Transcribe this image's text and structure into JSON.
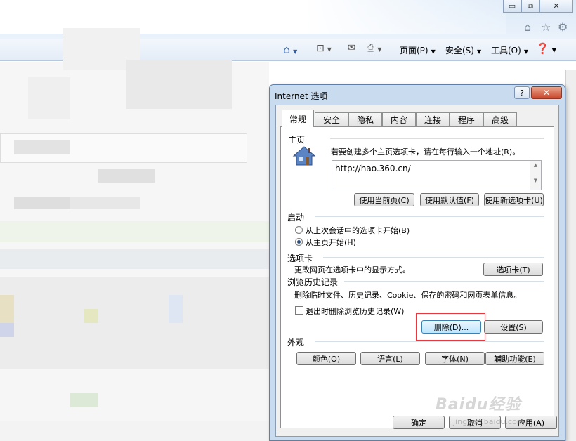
{
  "browser": {
    "window_controls": {
      "minimize": "▭",
      "restore": "⧉",
      "close": "✕"
    },
    "command_bar": {
      "page_label": "页面(P)",
      "safety_label": "安全(S)",
      "tools_label": "工具(O)"
    },
    "icons": [
      "home-icon",
      "star-icon",
      "gear-icon",
      "feeds-icon",
      "mail-icon",
      "print-icon",
      "help-icon"
    ]
  },
  "dialog": {
    "title": "Internet 选项",
    "help": "?",
    "close": "✕",
    "tabs": [
      "常规",
      "安全",
      "隐私",
      "内容",
      "连接",
      "程序",
      "高级"
    ],
    "homepage": {
      "heading": "主页",
      "hint": "若要创建多个主页选项卡，请在每行输入一个地址(R)。",
      "url": "http://hao.360.cn/",
      "use_current": "使用当前页(C)",
      "use_default": "使用默认值(F)",
      "use_new_tab": "使用新选项卡(U)"
    },
    "startup": {
      "heading": "启动",
      "option1": "从上次会话中的选项卡开始(B)",
      "option2": "从主页开始(H)",
      "selected": 2
    },
    "tabs_section": {
      "heading": "选项卡",
      "desc": "更改网页在选项卡中的显示方式。",
      "button": "选项卡(T)"
    },
    "history": {
      "heading": "浏览历史记录",
      "desc": "删除临时文件、历史记录、Cookie、保存的密码和网页表单信息。",
      "checkbox": "退出时删除浏览历史记录(W)",
      "checked": false,
      "delete": "删除(D)...",
      "settings": "设置(S)"
    },
    "appearance": {
      "heading": "外观",
      "colors": "颜色(O)",
      "languages": "语言(L)",
      "fonts": "字体(N)",
      "accessibility": "辅助功能(E)"
    },
    "footer": {
      "ok": "确定",
      "cancel": "取消",
      "apply": "应用(A)"
    }
  },
  "watermark": {
    "text": "Baidu经验",
    "url_text": "jingyan.baidu.com"
  },
  "colors": {
    "dialog_frame": "#c9dbef",
    "close_red": "#c9452a",
    "highlight": "#e8383d"
  }
}
